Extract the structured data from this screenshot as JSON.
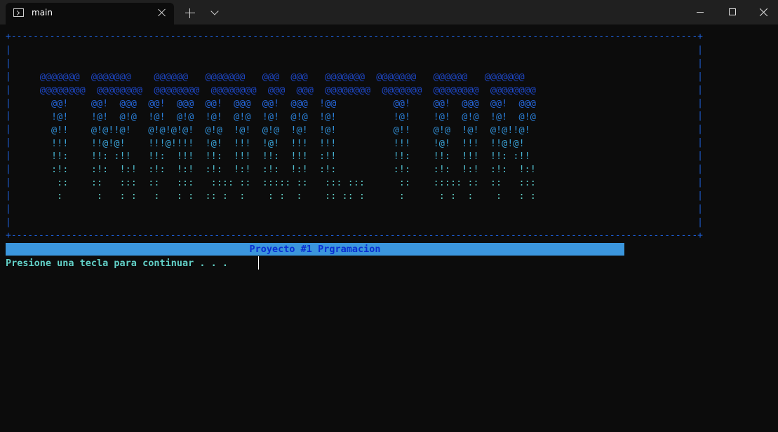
{
  "window": {
    "tab_title": "main",
    "tab_icon": "terminal-icon"
  },
  "console": {
    "frame_lines": [
      "+-----------------------------------------------------------------------------------------------------------------------------+",
      "|                                                                                                                             |",
      "|                                                                                                                             |",
      "|                                                                                                                             |",
      "|                                                                                                                             |",
      "|                                                                                                                             |",
      "|                                                                                                                             |",
      "|                                                                                                                             |",
      "|                                                                                                                             |",
      "|                                                                                                                             |",
      "|                                                                                                                             |",
      "|                                                                                                                             |",
      "|                                                                                                                             |",
      "|                                                                                                                             |",
      "|                                                                                                                             |",
      "+-----------------------------------------------------------------------------------------------------------------------------+"
    ],
    "art_lines": [
      {
        "text": "      @@@@@@@  @@@@@@@    @@@@@@   @@@@@@@   @@@  @@@   @@@@@@@  @@@@@@@   @@@@@@   @@@@@@@",
        "color": "#1e48c8"
      },
      {
        "text": "      @@@@@@@@  @@@@@@@@  @@@@@@@@  @@@@@@@@  @@@  @@@  @@@@@@@@  @@@@@@@  @@@@@@@@  @@@@@@@@",
        "color": "#1e48c8"
      },
      {
        "text": "        @@!    @@!  @@@  @@!  @@@  @@!  @@@  @@!  @@@  !@@          @@!    @@!  @@@  @@!  @@@",
        "color": "#2565d6"
      },
      {
        "text": "        !@!    !@!  @!@  !@!  @!@  !@!  @!@  !@!  @!@  !@!          !@!    !@!  @!@  !@!  @!@",
        "color": "#2a7fd8"
      },
      {
        "text": "        @!!    @!@!!@!   @!@!@!@!  @!@  !@!  @!@  !@!  !@!          @!!    @!@  !@!  @!@!!@!",
        "color": "#3292da"
      },
      {
        "text": "        !!!    !!@!@!    !!!@!!!!  !@!  !!!  !@!  !!!  !!!          !!!    !@!  !!!  !!@!@!",
        "color": "#3aa2d6"
      },
      {
        "text": "        !!:    !!: :!!   !!:  !!!  !!:  !!!  !!:  !!!  :!!          !!:    !!:  !!!  !!: :!!",
        "color": "#45b1d0"
      },
      {
        "text": "        :!:    :!:  !:!  :!:  !:!  :!:  !:!  :!:  !:!  :!:          :!:    :!:  !:!  :!:  !:!",
        "color": "#50bccb"
      },
      {
        "text": "         ::    ::   :::  ::   :::   :::: ::  ::::: ::   ::: :::      ::    ::::: ::  ::   :::",
        "color": "#5ac6c6"
      },
      {
        "text": "         :      :   : :   :   : :  :: :  :    : :  :    :: :: :      :      : :  :    :   : :",
        "color": "#62d0c7"
      }
    ],
    "banner_text": "Proyecto #1 Prgramacion",
    "prompt_text": "Presione una tecla para continuar . . ."
  },
  "colors": {
    "background": "#0c0c0c",
    "frame": "#1d5fd8",
    "banner_bg": "#3b96dd",
    "banner_text": "#0a2fd2",
    "prompt": "#62d0c7"
  }
}
